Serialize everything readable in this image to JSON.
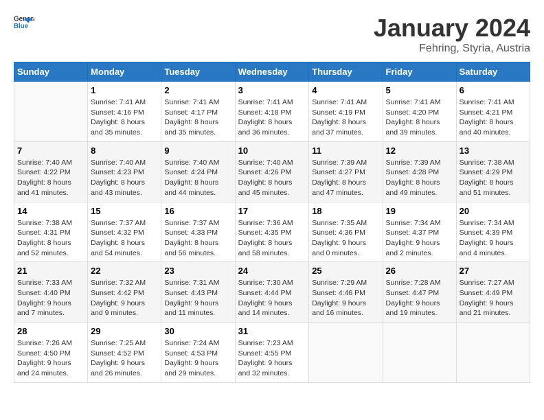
{
  "logo": {
    "general": "General",
    "blue": "Blue"
  },
  "title": "January 2024",
  "subtitle": "Fehring, Styria, Austria",
  "weekdays": [
    "Sunday",
    "Monday",
    "Tuesday",
    "Wednesday",
    "Thursday",
    "Friday",
    "Saturday"
  ],
  "weeks": [
    [
      {
        "day": "",
        "info": ""
      },
      {
        "day": "1",
        "info": "Sunrise: 7:41 AM\nSunset: 4:16 PM\nDaylight: 8 hours\nand 35 minutes."
      },
      {
        "day": "2",
        "info": "Sunrise: 7:41 AM\nSunset: 4:17 PM\nDaylight: 8 hours\nand 35 minutes."
      },
      {
        "day": "3",
        "info": "Sunrise: 7:41 AM\nSunset: 4:18 PM\nDaylight: 8 hours\nand 36 minutes."
      },
      {
        "day": "4",
        "info": "Sunrise: 7:41 AM\nSunset: 4:19 PM\nDaylight: 8 hours\nand 37 minutes."
      },
      {
        "day": "5",
        "info": "Sunrise: 7:41 AM\nSunset: 4:20 PM\nDaylight: 8 hours\nand 39 minutes."
      },
      {
        "day": "6",
        "info": "Sunrise: 7:41 AM\nSunset: 4:21 PM\nDaylight: 8 hours\nand 40 minutes."
      }
    ],
    [
      {
        "day": "7",
        "info": "Sunrise: 7:40 AM\nSunset: 4:22 PM\nDaylight: 8 hours\nand 41 minutes."
      },
      {
        "day": "8",
        "info": "Sunrise: 7:40 AM\nSunset: 4:23 PM\nDaylight: 8 hours\nand 43 minutes."
      },
      {
        "day": "9",
        "info": "Sunrise: 7:40 AM\nSunset: 4:24 PM\nDaylight: 8 hours\nand 44 minutes."
      },
      {
        "day": "10",
        "info": "Sunrise: 7:40 AM\nSunset: 4:26 PM\nDaylight: 8 hours\nand 45 minutes."
      },
      {
        "day": "11",
        "info": "Sunrise: 7:39 AM\nSunset: 4:27 PM\nDaylight: 8 hours\nand 47 minutes."
      },
      {
        "day": "12",
        "info": "Sunrise: 7:39 AM\nSunset: 4:28 PM\nDaylight: 8 hours\nand 49 minutes."
      },
      {
        "day": "13",
        "info": "Sunrise: 7:38 AM\nSunset: 4:29 PM\nDaylight: 8 hours\nand 51 minutes."
      }
    ],
    [
      {
        "day": "14",
        "info": "Sunrise: 7:38 AM\nSunset: 4:31 PM\nDaylight: 8 hours\nand 52 minutes."
      },
      {
        "day": "15",
        "info": "Sunrise: 7:37 AM\nSunset: 4:32 PM\nDaylight: 8 hours\nand 54 minutes."
      },
      {
        "day": "16",
        "info": "Sunrise: 7:37 AM\nSunset: 4:33 PM\nDaylight: 8 hours\nand 56 minutes."
      },
      {
        "day": "17",
        "info": "Sunrise: 7:36 AM\nSunset: 4:35 PM\nDaylight: 8 hours\nand 58 minutes."
      },
      {
        "day": "18",
        "info": "Sunrise: 7:35 AM\nSunset: 4:36 PM\nDaylight: 9 hours\nand 0 minutes."
      },
      {
        "day": "19",
        "info": "Sunrise: 7:34 AM\nSunset: 4:37 PM\nDaylight: 9 hours\nand 2 minutes."
      },
      {
        "day": "20",
        "info": "Sunrise: 7:34 AM\nSunset: 4:39 PM\nDaylight: 9 hours\nand 4 minutes."
      }
    ],
    [
      {
        "day": "21",
        "info": "Sunrise: 7:33 AM\nSunset: 4:40 PM\nDaylight: 9 hours\nand 7 minutes."
      },
      {
        "day": "22",
        "info": "Sunrise: 7:32 AM\nSunset: 4:42 PM\nDaylight: 9 hours\nand 9 minutes."
      },
      {
        "day": "23",
        "info": "Sunrise: 7:31 AM\nSunset: 4:43 PM\nDaylight: 9 hours\nand 11 minutes."
      },
      {
        "day": "24",
        "info": "Sunrise: 7:30 AM\nSunset: 4:44 PM\nDaylight: 9 hours\nand 14 minutes."
      },
      {
        "day": "25",
        "info": "Sunrise: 7:29 AM\nSunset: 4:46 PM\nDaylight: 9 hours\nand 16 minutes."
      },
      {
        "day": "26",
        "info": "Sunrise: 7:28 AM\nSunset: 4:47 PM\nDaylight: 9 hours\nand 19 minutes."
      },
      {
        "day": "27",
        "info": "Sunrise: 7:27 AM\nSunset: 4:49 PM\nDaylight: 9 hours\nand 21 minutes."
      }
    ],
    [
      {
        "day": "28",
        "info": "Sunrise: 7:26 AM\nSunset: 4:50 PM\nDaylight: 9 hours\nand 24 minutes."
      },
      {
        "day": "29",
        "info": "Sunrise: 7:25 AM\nSunset: 4:52 PM\nDaylight: 9 hours\nand 26 minutes."
      },
      {
        "day": "30",
        "info": "Sunrise: 7:24 AM\nSunset: 4:53 PM\nDaylight: 9 hours\nand 29 minutes."
      },
      {
        "day": "31",
        "info": "Sunrise: 7:23 AM\nSunset: 4:55 PM\nDaylight: 9 hours\nand 32 minutes."
      },
      {
        "day": "",
        "info": ""
      },
      {
        "day": "",
        "info": ""
      },
      {
        "day": "",
        "info": ""
      }
    ]
  ]
}
